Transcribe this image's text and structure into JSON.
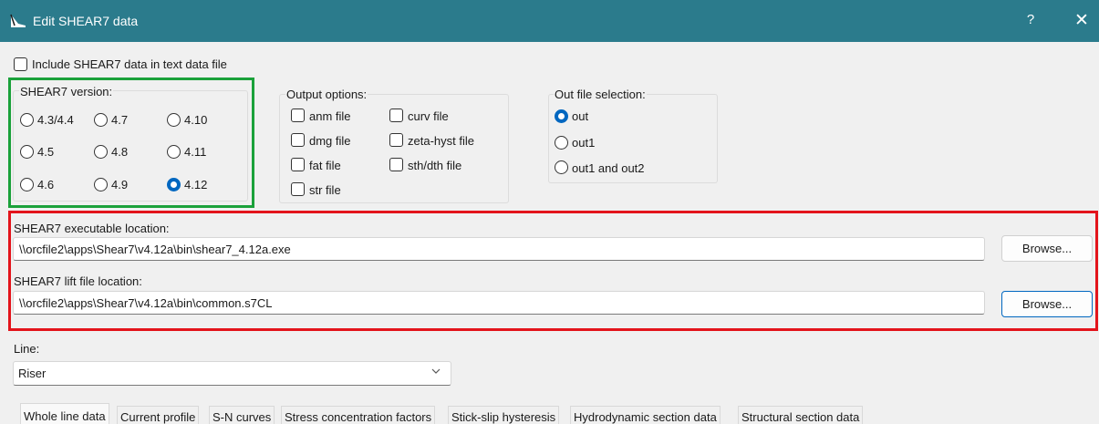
{
  "window": {
    "title": "Edit SHEAR7 data",
    "help_label": "?",
    "close_label": "✕"
  },
  "include_checkbox": {
    "label": "Include SHEAR7 data in text data file",
    "checked": false
  },
  "version_group": {
    "label": "SHEAR7 version:",
    "options": [
      "4.3/4.4",
      "4.7",
      "4.10",
      "4.5",
      "4.8",
      "4.11",
      "4.6",
      "4.9",
      "4.12"
    ],
    "selected": "4.12"
  },
  "output_options": {
    "label": "Output options:",
    "items": [
      "anm file",
      "curv file",
      "dmg file",
      "zeta-hyst file",
      "fat file",
      "sth/dth file",
      "str file"
    ]
  },
  "out_file_selection": {
    "label": "Out file selection:",
    "options": [
      "out",
      "out1",
      "out1 and out2"
    ],
    "selected": "out"
  },
  "executable": {
    "label": "SHEAR7 executable location:",
    "value": "\\\\orcfile2\\apps\\Shear7\\v4.12a\\bin\\shear7_4.12a.exe",
    "browse_label": "Browse..."
  },
  "lift_file": {
    "label": "SHEAR7 lift file location:",
    "value": "\\\\orcfile2\\apps\\Shear7\\v4.12a\\bin\\common.s7CL",
    "browse_label": "Browse..."
  },
  "line": {
    "label": "Line:",
    "value": "Riser"
  },
  "tabs": [
    "Whole line data",
    "Current profile",
    "S-N curves",
    "Stress concentration factors",
    "Stick-slip hysteresis",
    "Hydrodynamic section data",
    "Structural section data"
  ],
  "colors": {
    "titlebar": "#2b7b8c",
    "accent": "#0067c0",
    "highlight_green": "#1aa13a",
    "highlight_red": "#e3141b"
  }
}
